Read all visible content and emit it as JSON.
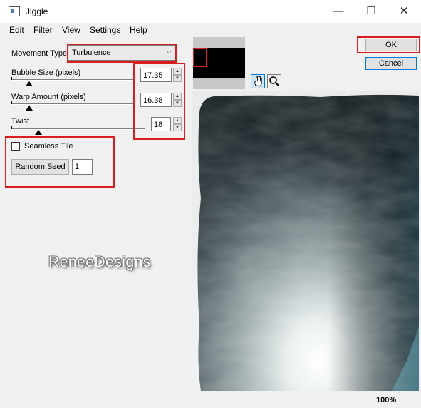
{
  "window": {
    "title": "Jiggle",
    "minimize": "—",
    "maximize": "☐",
    "close": "✕"
  },
  "menu": [
    "Edit",
    "Filter",
    "View",
    "Settings",
    "Help"
  ],
  "movement": {
    "label": "Movement Type",
    "value": "Turbulence"
  },
  "bubble": {
    "label": "Bubble Size (pixels)",
    "value": "17.35",
    "level": 0.1
  },
  "warp": {
    "label": "Warp Amount (pixels)",
    "value": "16.38",
    "level": 0.1
  },
  "twist": {
    "label": "Twist",
    "value": "18",
    "level": 0.15
  },
  "seamless": {
    "label": "Seamless Tile",
    "checked": false
  },
  "seed": {
    "button": "Random Seed",
    "value": "1"
  },
  "buttons": {
    "ok": "OK",
    "cancel": "Cancel"
  },
  "status": {
    "zoom": "100%"
  },
  "watermark": "ReneeDesigns",
  "colors": {
    "highlight_red": "#d81e1e",
    "cancel_border": "#0078d7"
  },
  "icons": {
    "pan": "hand-icon",
    "zoom": "magnifier-icon"
  }
}
